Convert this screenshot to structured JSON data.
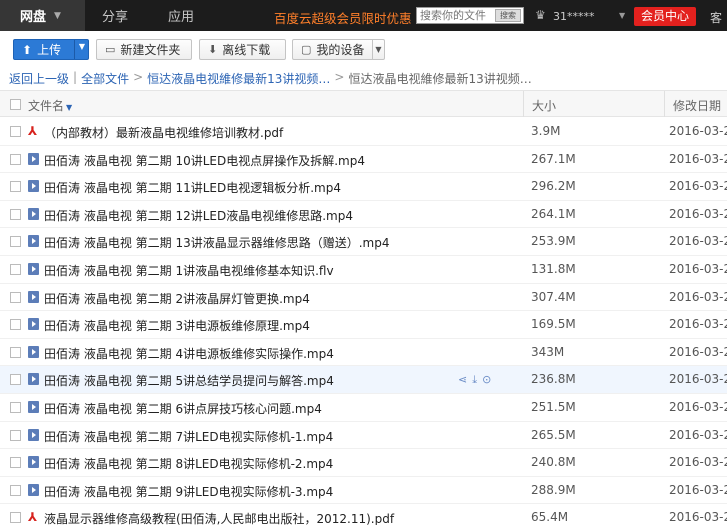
{
  "nav": {
    "tabs": [
      {
        "label": "网盘"
      },
      {
        "label": "分享"
      },
      {
        "label": "应用"
      }
    ],
    "promo": "百度云超级会员限时优惠",
    "search_placeholder": "搜索你的文件",
    "search_button": "搜索",
    "username": "31*****",
    "vip_button": "会员中心",
    "more": "客"
  },
  "toolbar": {
    "upload": "上传",
    "new_folder": "新建文件夹",
    "offline_download": "离线下载",
    "my_devices": "我的设备"
  },
  "breadcrumb": {
    "back": "返回上一级",
    "all_files": "全部文件",
    "parent": "恒达液晶电视維修最新13讲视频…",
    "current": "恒达液晶电视維修最新13讲视频…"
  },
  "table": {
    "headers": {
      "name": "文件名",
      "size": "大小",
      "date": "修改日期"
    },
    "rows": [
      {
        "type": "pdf",
        "name": "（内部教材）最新液晶电视维修培训教材.pdf",
        "size": "3.9M",
        "date": "2016-03-2"
      },
      {
        "type": "video",
        "name": "田佰涛 液晶电视 第二期 10讲LED电视点屏操作及拆解.mp4",
        "size": "267.1M",
        "date": "2016-03-2"
      },
      {
        "type": "video",
        "name": "田佰涛 液晶电视 第二期 11讲LED电视逻辑板分析.mp4",
        "size": "296.2M",
        "date": "2016-03-2"
      },
      {
        "type": "video",
        "name": "田佰涛 液晶电视 第二期 12讲LED液晶电视维修思路.mp4",
        "size": "264.1M",
        "date": "2016-03-2"
      },
      {
        "type": "video",
        "name": "田佰涛 液晶电视 第二期 13讲液晶显示器维修思路（赠送）.mp4",
        "size": "253.9M",
        "date": "2016-03-2"
      },
      {
        "type": "video",
        "name": "田佰涛 液晶电视 第二期 1讲液晶电视维修基本知识.flv",
        "size": "131.8M",
        "date": "2016-03-2"
      },
      {
        "type": "video",
        "name": "田佰涛 液晶电视 第二期 2讲液晶屏灯管更换.mp4",
        "size": "307.4M",
        "date": "2016-03-2"
      },
      {
        "type": "video",
        "name": "田佰涛 液晶电视 第二期 3讲电源板维修原理.mp4",
        "size": "169.5M",
        "date": "2016-03-2"
      },
      {
        "type": "video",
        "name": "田佰涛 液晶电视 第二期 4讲电源板维修实际操作.mp4",
        "size": "343M",
        "date": "2016-03-2"
      },
      {
        "type": "video",
        "name": "田佰涛 液晶电视 第二期 5讲总结学员提问与解答.mp4",
        "size": "236.8M",
        "date": "2016-03-2"
      },
      {
        "type": "video",
        "name": "田佰涛 液晶电视 第二期 6讲点屏技巧核心问题.mp4",
        "size": "251.5M",
        "date": "2016-03-2"
      },
      {
        "type": "video",
        "name": "田佰涛 液晶电视 第二期 7讲LED电视实际修机-1.mp4",
        "size": "265.5M",
        "date": "2016-03-2"
      },
      {
        "type": "video",
        "name": "田佰涛 液晶电视 第二期 8讲LED电视实际修机-2.mp4",
        "size": "240.8M",
        "date": "2016-03-2"
      },
      {
        "type": "video",
        "name": "田佰涛 液晶电视 第二期 9讲LED电视实际修机-3.mp4",
        "size": "288.9M",
        "date": "2016-03-2"
      },
      {
        "type": "pdf",
        "name": "液晶显示器维修高级教程(田佰涛,人民邮电出版社，2012.11).pdf",
        "size": "65.4M",
        "date": "2016-03-2"
      }
    ]
  }
}
